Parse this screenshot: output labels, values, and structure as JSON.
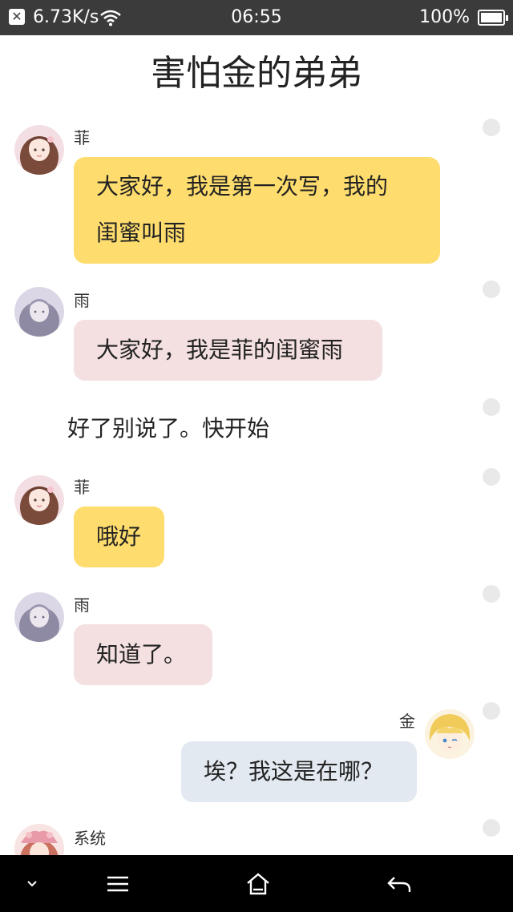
{
  "status_bar": {
    "network_speed": "6.73K/s",
    "time": "06:55",
    "battery_percent": "100%",
    "icons": [
      "notification-x-icon",
      "wifi-icon",
      "battery-icon"
    ]
  },
  "chat": {
    "title": "害怕金的弟弟"
  },
  "messages": [
    {
      "sender": "菲",
      "text_lines": [
        "大家好，我是第一次写，我的",
        "闺蜜叫雨"
      ],
      "side": "left",
      "bubble_color": "#fedd6e"
    },
    {
      "sender": "雨",
      "text_lines": [
        "大家好，我是菲的闺蜜雨"
      ],
      "side": "left",
      "bubble_color": "#f4e0e0"
    },
    {
      "sender": "",
      "text_lines": [
        "好了别说了。快开始"
      ],
      "side": "narration"
    },
    {
      "sender": "菲",
      "text_lines": [
        "哦好"
      ],
      "side": "left",
      "bubble_color": "#fedd6e"
    },
    {
      "sender": "雨",
      "text_lines": [
        "知道了。"
      ],
      "side": "left",
      "bubble_color": "#f4e0e0"
    },
    {
      "sender": "金",
      "text_lines": [
        "埃？我这是在哪？"
      ],
      "side": "right",
      "bubble_color": "#e2e9f0"
    },
    {
      "sender": "系统",
      "text_lines": [],
      "side": "left"
    }
  ],
  "nav_bar": {
    "icons": [
      "chevron-down-icon",
      "menu-icon",
      "home-icon",
      "back-icon"
    ]
  }
}
